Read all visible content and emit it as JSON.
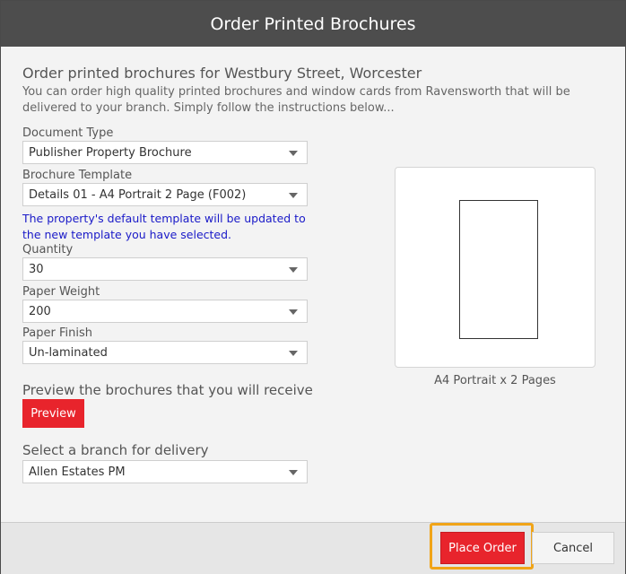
{
  "dialog": {
    "title": "Order Printed Brochures"
  },
  "main": {
    "heading": "Order printed brochures for Westbury Street, Worcester",
    "intro": "You can order high quality printed brochures and window cards from Ravensworth that will be delivered to your branch. Simply follow the instructions below...",
    "fields": {
      "document_type": {
        "label": "Document Type",
        "value": "Publisher Property Brochure"
      },
      "brochure_template": {
        "label": "Brochure Template",
        "value": "Details 01 - A4 Portrait 2 Page (F002)"
      },
      "template_note": "The property's default template will be updated to the new template you have selected.",
      "quantity": {
        "label": "Quantity",
        "value": "30"
      },
      "paper_weight": {
        "label": "Paper Weight",
        "value": "200"
      },
      "paper_finish": {
        "label": "Paper Finish",
        "value": "Un-laminated"
      }
    },
    "preview_section": {
      "label": "Preview the brochures that you will receive",
      "button_label": "Preview"
    },
    "delivery": {
      "label": "Select a branch for delivery",
      "value": "Allen Estates PM"
    },
    "preview_card": {
      "caption": "A4 Portrait x 2 Pages"
    }
  },
  "footer": {
    "place_order_label": "Place Order",
    "cancel_label": "Cancel"
  },
  "colors": {
    "title_bar": "#4d4d4d",
    "accent_red": "#e8242c",
    "focus_ring": "#f0a418",
    "note_text": "#1a1ac8"
  }
}
